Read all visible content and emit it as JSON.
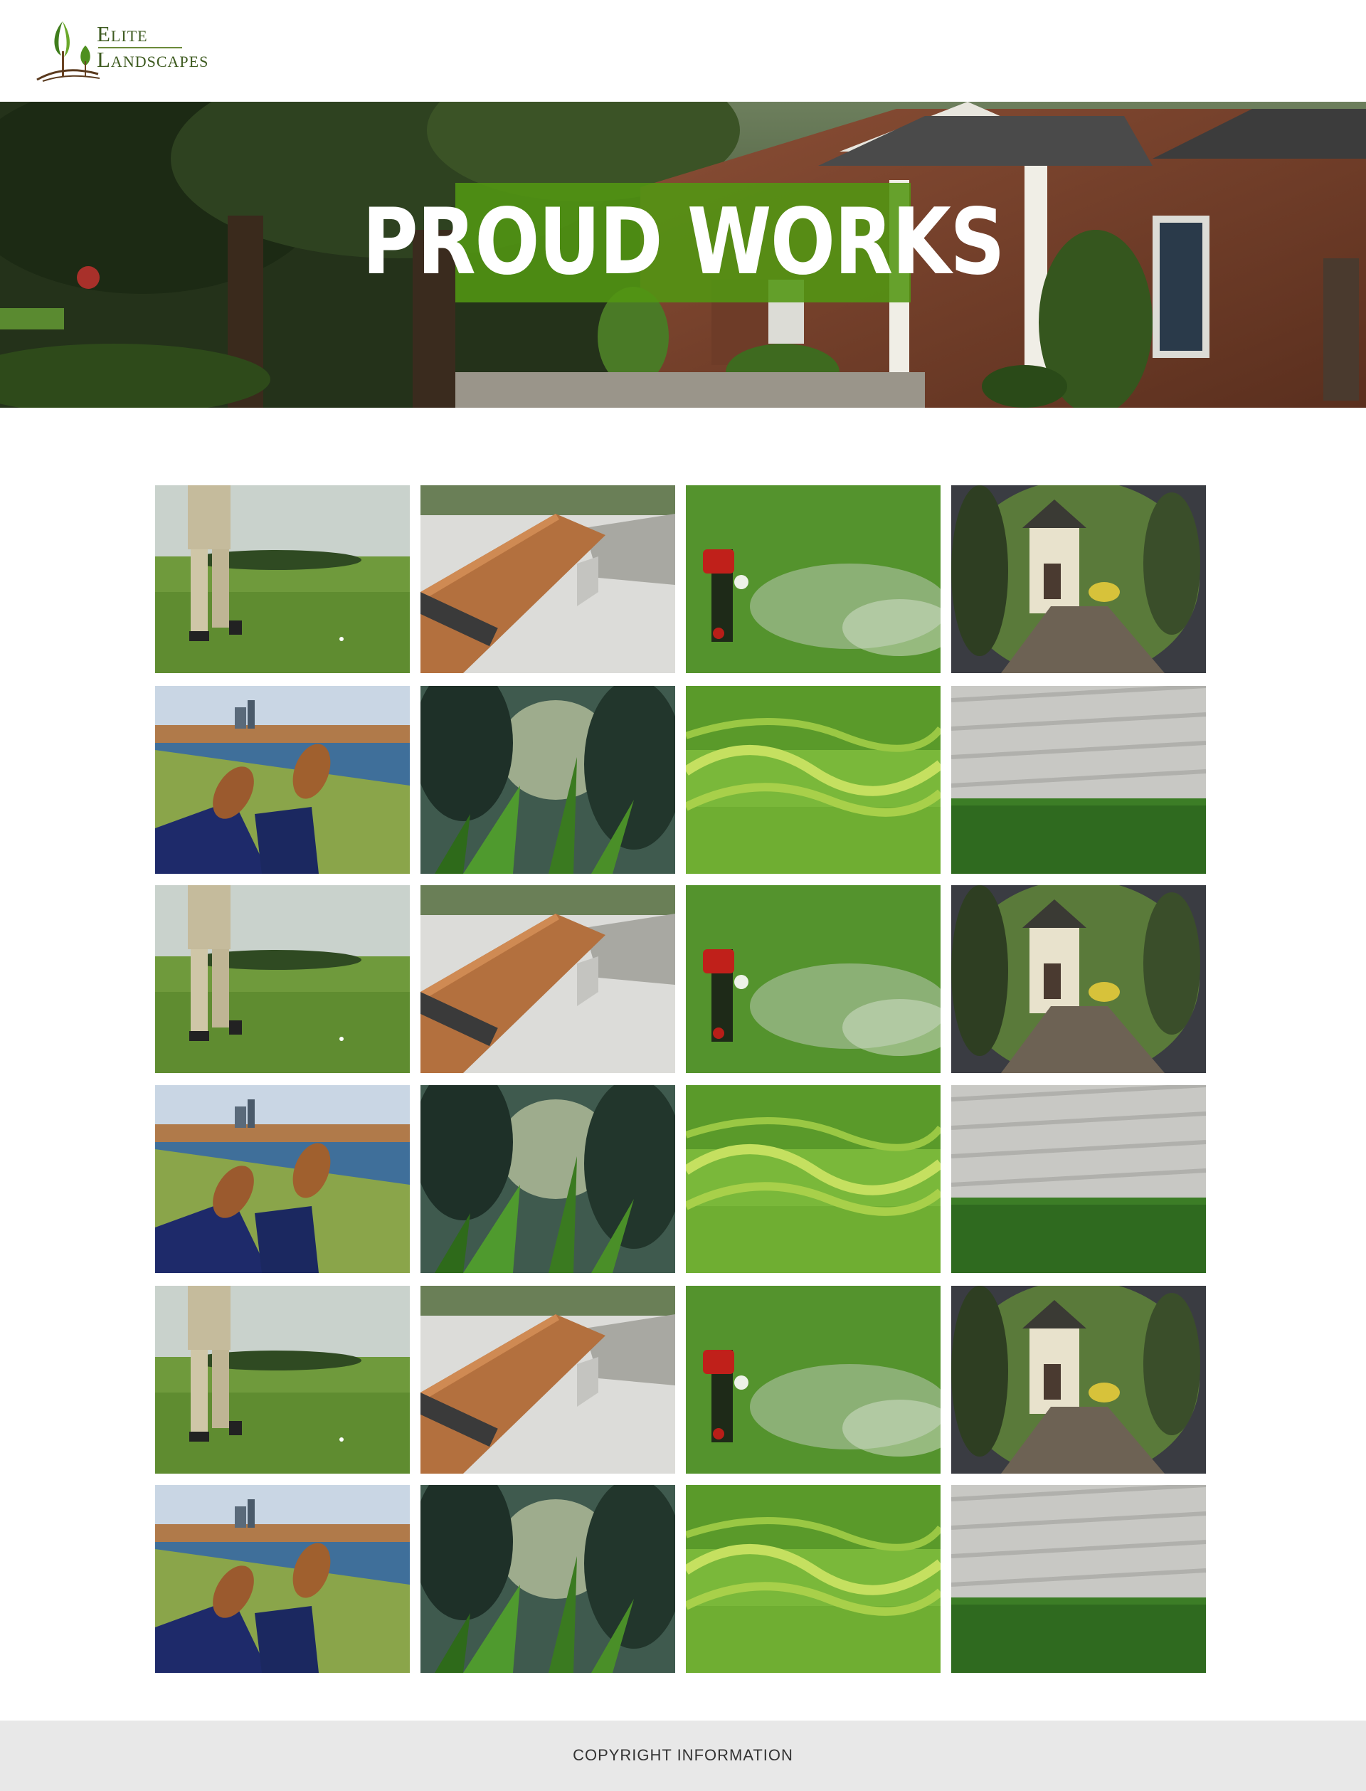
{
  "logo": {
    "word1": "Elite",
    "word2": "Landscapes",
    "icon": "tree-logo-icon"
  },
  "hero": {
    "title": "PROUD WORKS",
    "accent_color": "#529612"
  },
  "gallery": {
    "images": [
      "golfer-photo",
      "bench-photo",
      "sprinkler-photo",
      "cottage-photo",
      "riverbank-photo",
      "grass-bokeh-photo",
      "lawn-closeup-photo",
      "wall-and-turf-photo"
    ],
    "rows": 6
  },
  "footer": {
    "text": "COPYRIGHT INFORMATION"
  }
}
